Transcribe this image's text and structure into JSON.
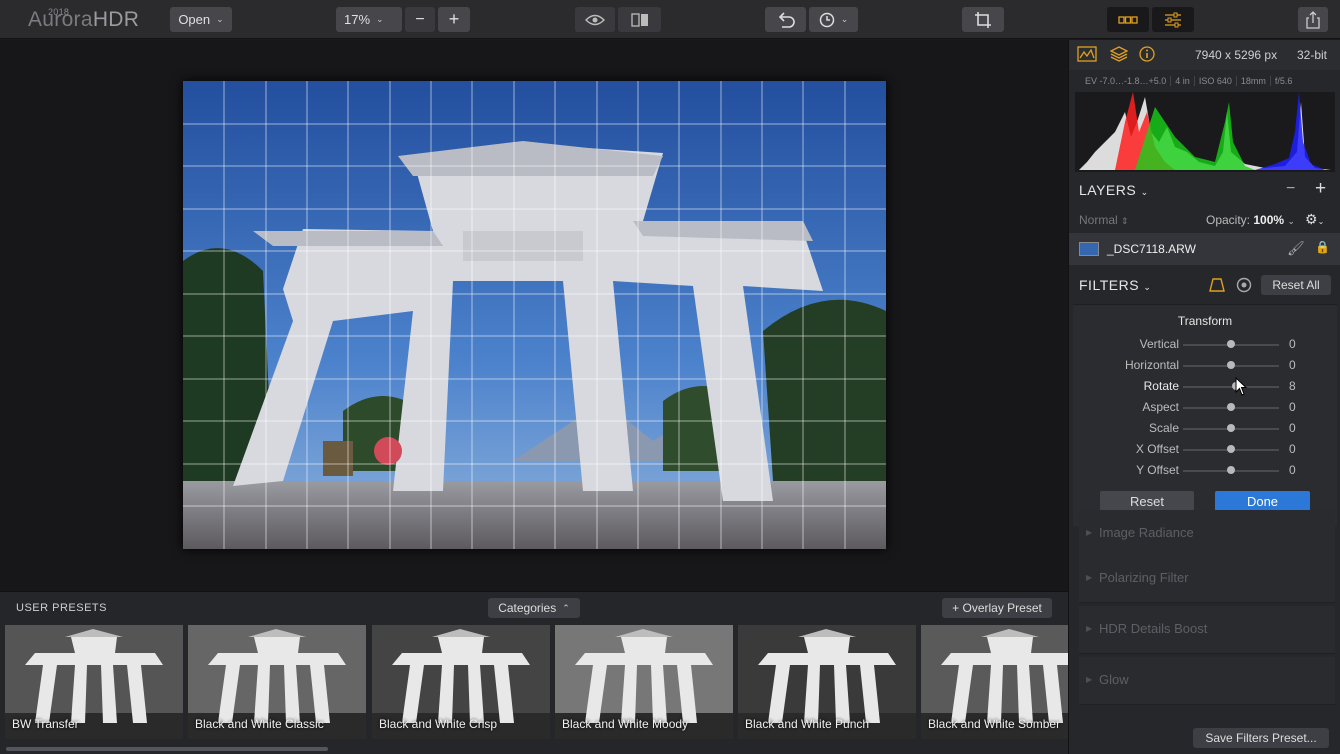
{
  "app": {
    "logo_year": "2018",
    "logo_name": "Aurora",
    "logo_suffix": "HDR"
  },
  "toolbar": {
    "open_label": "Open",
    "zoom_value": "17%",
    "zoom_out": "−",
    "zoom_in": "+",
    "icons": [
      "eye-icon",
      "compare-icon",
      "undo-icon",
      "history-icon",
      "crop-icon",
      "presets-view-icon",
      "sliders-icon",
      "share-icon"
    ]
  },
  "presets": {
    "title": "USER PRESETS",
    "categories_label": "Categories",
    "overlay_label": "+ Overlay Preset",
    "items": [
      {
        "label": "BW Transfer"
      },
      {
        "label": "Black and White Classic"
      },
      {
        "label": "Black and White Crisp"
      },
      {
        "label": "Black and White Moody"
      },
      {
        "label": "Black and White Punch"
      },
      {
        "label": "Black and White Somber"
      }
    ]
  },
  "panel": {
    "dimensions": "7940 x 5296 px",
    "bit_depth": "32-bit",
    "exif": [
      "EV  -7.0…-1.8…+5.0",
      "4 in",
      "ISO 640",
      "18mm",
      "f/5.6"
    ],
    "layers_title": "LAYERS",
    "blend_mode": "Normal",
    "opacity_label": "Opacity:",
    "opacity_value": "100%",
    "layer_name": "_DSC7118.ARW",
    "filters_title": "FILTERS",
    "reset_all": "Reset All",
    "transform": {
      "title": "Transform",
      "sliders": [
        {
          "name": "Vertical",
          "value": "0",
          "level": 0.5
        },
        {
          "name": "Horizontal",
          "value": "0",
          "level": 0.5
        },
        {
          "name": "Rotate",
          "value": "8",
          "level": 0.55
        },
        {
          "name": "Aspect",
          "value": "0",
          "level": 0.5
        },
        {
          "name": "Scale",
          "value": "0",
          "level": 0.5
        },
        {
          "name": "X Offset",
          "value": "0",
          "level": 0.5
        },
        {
          "name": "Y Offset",
          "value": "0",
          "level": 0.5
        }
      ],
      "reset_label": "Reset",
      "done_label": "Done"
    },
    "collapsed_filters": [
      "Image Radiance",
      "Polarizing Filter",
      "HDR Details Boost",
      "Glow"
    ],
    "save_label": "Save Filters Preset..."
  },
  "colors": {
    "accent": "#e0a020",
    "done_button": "#2b78d8",
    "sky": "#2e5fae"
  }
}
